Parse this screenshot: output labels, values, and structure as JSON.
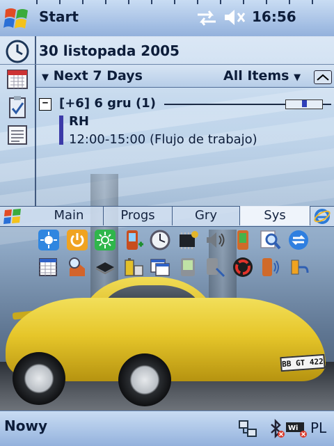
{
  "taskbar": {
    "start_label": "Start",
    "time": "16:56"
  },
  "today": {
    "date": "30 listopada 2005",
    "calendar": {
      "range_label": "Next 7 Days",
      "filter_label": "All Items",
      "group_label": "[+6] 6 gru (1)",
      "expand_symbol": "−",
      "appointment": {
        "title": "RH",
        "detail": "12:00-15:00 (Flujo de trabajo)"
      }
    }
  },
  "tabs": [
    {
      "label": "Main"
    },
    {
      "label": "Progs"
    },
    {
      "label": "Gry"
    },
    {
      "label": "Sys",
      "selected": true
    }
  ],
  "program_icons_row1": [
    "settings-sun-icon",
    "power-icon",
    "backlight-icon",
    "phone-plus-icon",
    "clock-icon",
    "memory-chip-icon",
    "speaker-icon",
    "device-color-icon",
    "magnifier-icon",
    "sync-arrows-icon"
  ],
  "program_icons_row2": [
    "calendar-grid-icon",
    "home-search-icon",
    "cpu-chip-icon",
    "battery-icon",
    "window-list-icon",
    "pda-icon",
    "device-search-icon",
    "recycle-icon",
    "phone-radio-icon",
    "power-plug-icon"
  ],
  "bottom": {
    "new_label": "Nowy",
    "language": "PL"
  },
  "license_plate": "BB GT 422",
  "colors": {
    "bar_top": "#c9dcf3",
    "bar_bottom": "#93b1dc",
    "appointment_bar": "#3c3aa8",
    "car_yellow": "#e6c62a"
  }
}
